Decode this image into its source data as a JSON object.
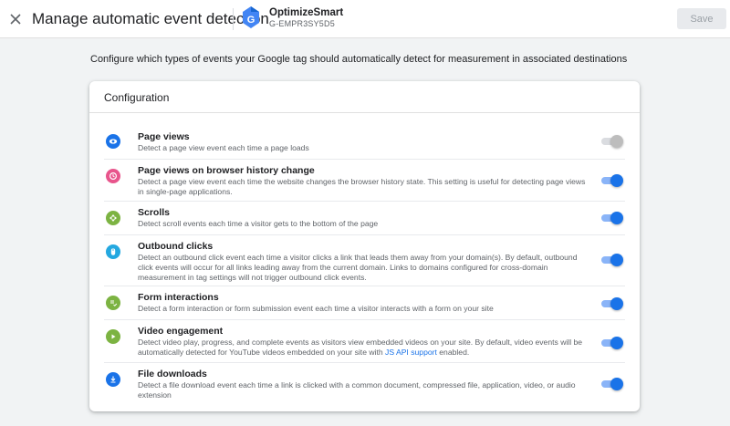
{
  "header": {
    "title": "Manage automatic event detection",
    "account_name": "OptimizeSmart",
    "tag_id": "G-EMPR3SY5D5",
    "save_label": "Save"
  },
  "intro": "Configure which types of events your Google tag should automatically detect for measurement in associated destinations",
  "card": {
    "title": "Configuration",
    "items": [
      {
        "label": "Page views",
        "desc": "Detect a page view event each time a page loads",
        "enabled": false,
        "icon": "eye-icon",
        "icon_color": "#1a73e8"
      },
      {
        "label": "Page views on browser history change",
        "desc": "Detect a page view event each time the website changes the browser history state. This setting is useful for detecting page views in single-page applications.",
        "enabled": true,
        "icon": "history-icon",
        "icon_color": "#e8558c"
      },
      {
        "label": "Scrolls",
        "desc": "Detect scroll events each time a visitor gets to the bottom of the page",
        "enabled": true,
        "icon": "scroll-arrows-icon",
        "icon_color": "#7cb342"
      },
      {
        "label": "Outbound clicks",
        "desc": "Detect an outbound click event each time a visitor clicks a link that leads them away from your domain(s). By default, outbound click events will occur for all links leading away from the current domain. Links to domains configured for cross-domain measurement in tag settings will not trigger outbound click events.",
        "enabled": true,
        "icon": "mouse-icon",
        "icon_color": "#24a8e0"
      },
      {
        "label": "Form interactions",
        "desc": "Detect a form interaction or form submission event each time a visitor interacts with a form on your site",
        "enabled": true,
        "icon": "form-icon",
        "icon_color": "#7cb342"
      },
      {
        "label": "Video engagement",
        "desc_before": "Detect video play, progress, and complete events as visitors view embedded videos on your site. By default, video events will be automatically detected for YouTube videos embedded on your site with ",
        "desc_link": "JS API support",
        "desc_after": " enabled.",
        "enabled": true,
        "icon": "play-icon",
        "icon_color": "#7cb342"
      },
      {
        "label": "File downloads",
        "desc": "Detect a file download event each time a link is clicked with a common document, compressed file, application, video, or audio extension",
        "enabled": true,
        "icon": "download-icon",
        "icon_color": "#1a73e8"
      }
    ]
  }
}
